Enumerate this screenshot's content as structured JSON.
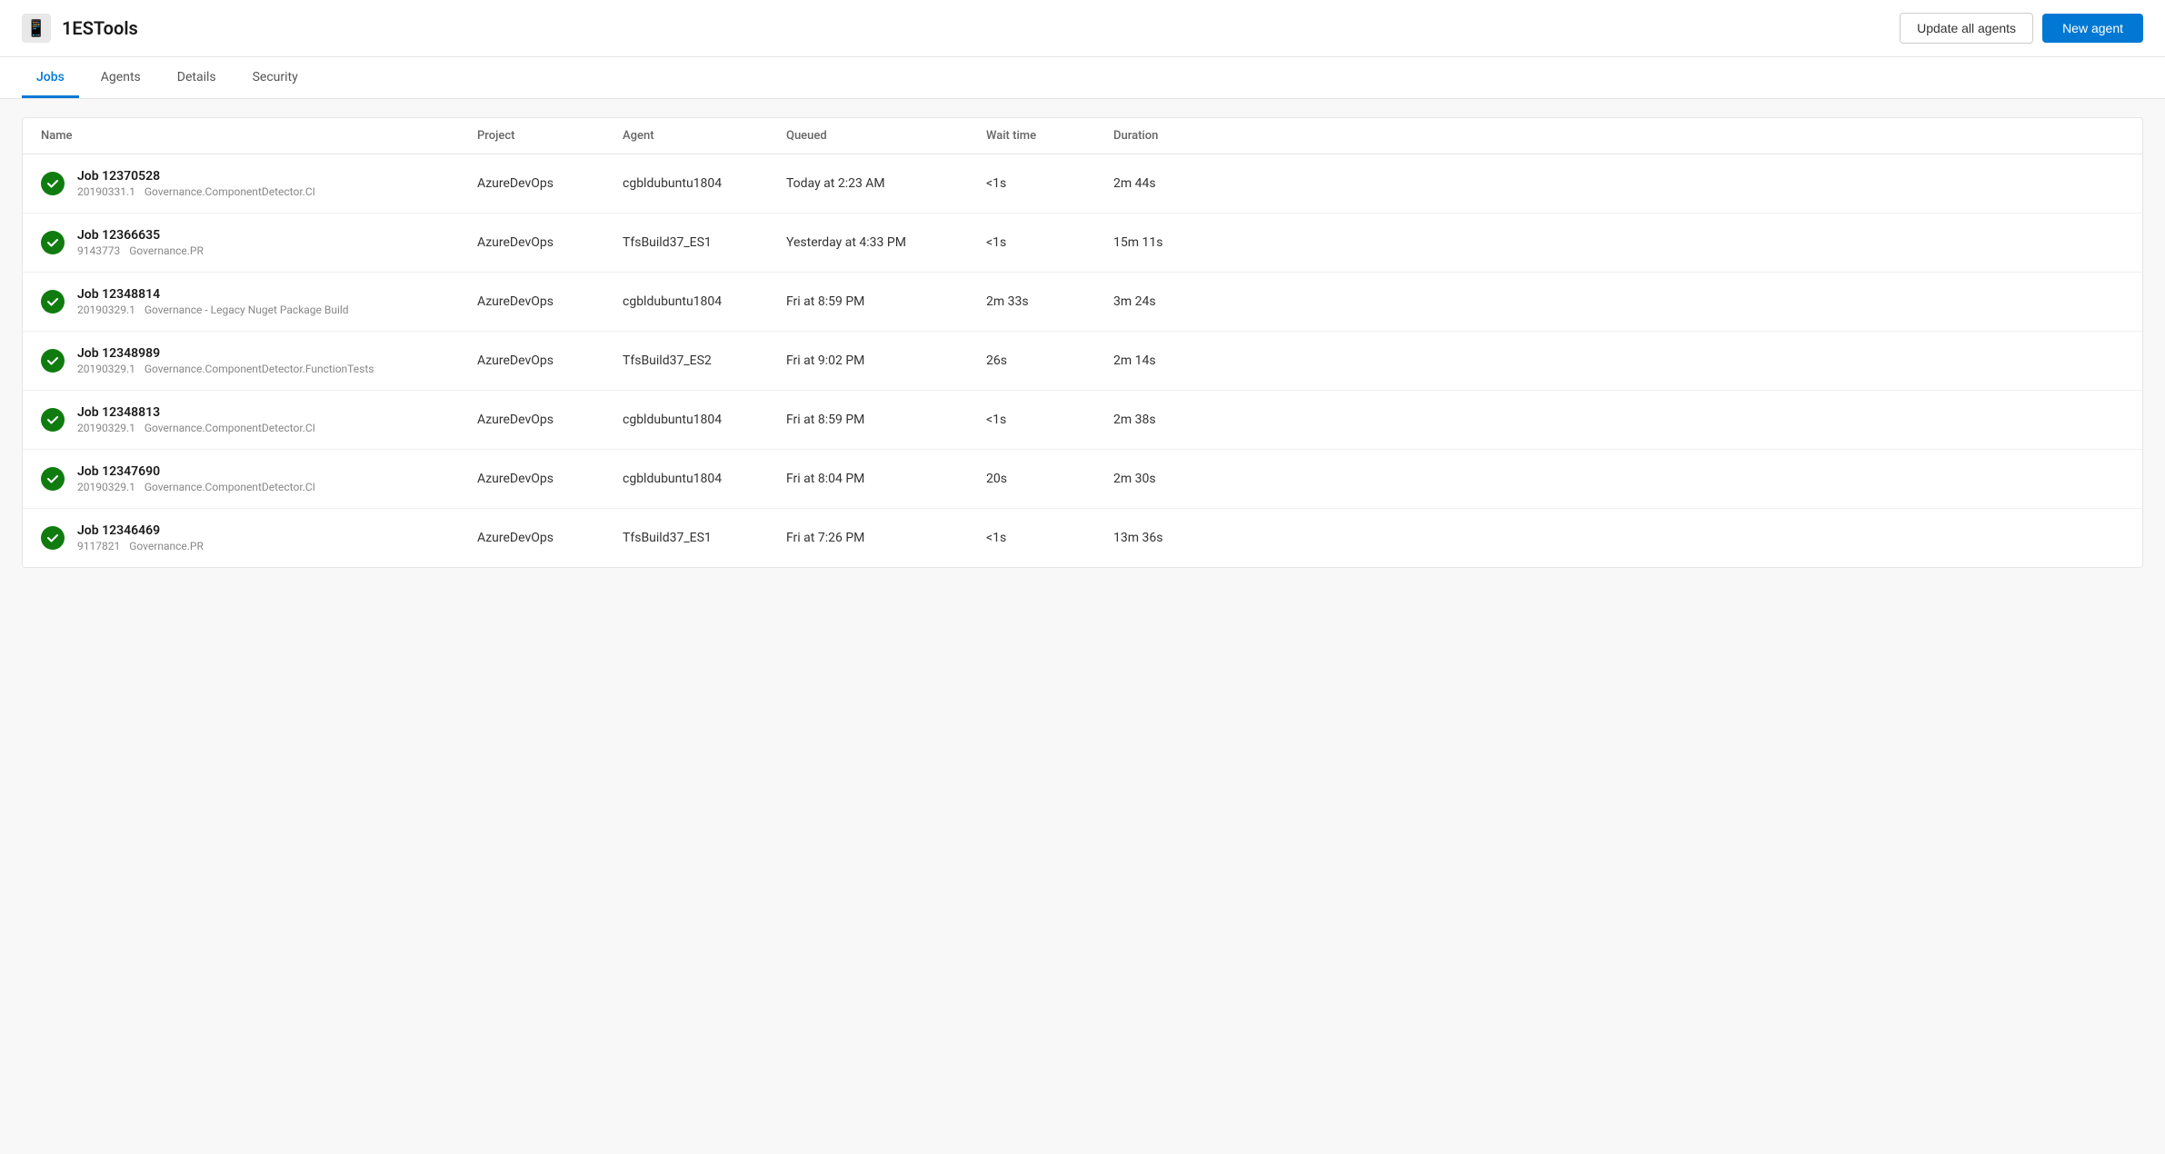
{
  "header": {
    "icon": "📱",
    "title": "1ESTools",
    "update_button": "Update all agents",
    "new_button": "New agent"
  },
  "tabs": [
    {
      "label": "Jobs",
      "active": true
    },
    {
      "label": "Agents",
      "active": false
    },
    {
      "label": "Details",
      "active": false
    },
    {
      "label": "Security",
      "active": false
    }
  ],
  "table": {
    "columns": [
      "Name",
      "Project",
      "Agent",
      "Queued",
      "Wait time",
      "Duration"
    ],
    "rows": [
      {
        "id": "Job 12370528",
        "sub1": "20190331.1",
        "sub2": "Governance.ComponentDetector.CI",
        "project": "AzureDevOps",
        "agent": "cgbldubuntu1804",
        "queued": "Today at 2:23 AM",
        "wait_time": "<1s",
        "duration": "2m 44s"
      },
      {
        "id": "Job 12366635",
        "sub1": "9143773",
        "sub2": "Governance.PR",
        "project": "AzureDevOps",
        "agent": "TfsBuild37_ES1",
        "queued": "Yesterday at 4:33 PM",
        "wait_time": "<1s",
        "duration": "15m 11s"
      },
      {
        "id": "Job 12348814",
        "sub1": "20190329.1",
        "sub2": "Governance - Legacy Nuget Package Build",
        "project": "AzureDevOps",
        "agent": "cgbldubuntu1804",
        "queued": "Fri at 8:59 PM",
        "wait_time": "2m 33s",
        "duration": "3m 24s"
      },
      {
        "id": "Job 12348989",
        "sub1": "20190329.1",
        "sub2": "Governance.ComponentDetector.FunctionTests",
        "project": "AzureDevOps",
        "agent": "TfsBuild37_ES2",
        "queued": "Fri at 9:02 PM",
        "wait_time": "26s",
        "duration": "2m 14s"
      },
      {
        "id": "Job 12348813",
        "sub1": "20190329.1",
        "sub2": "Governance.ComponentDetector.CI",
        "project": "AzureDevOps",
        "agent": "cgbldubuntu1804",
        "queued": "Fri at 8:59 PM",
        "wait_time": "<1s",
        "duration": "2m 38s"
      },
      {
        "id": "Job 12347690",
        "sub1": "20190329.1",
        "sub2": "Governance.ComponentDetector.CI",
        "project": "AzureDevOps",
        "agent": "cgbldubuntu1804",
        "queued": "Fri at 8:04 PM",
        "wait_time": "20s",
        "duration": "2m 30s"
      },
      {
        "id": "Job 12346469",
        "sub1": "9117821",
        "sub2": "Governance.PR",
        "project": "AzureDevOps",
        "agent": "TfsBuild37_ES1",
        "queued": "Fri at 7:26 PM",
        "wait_time": "<1s",
        "duration": "13m 36s"
      }
    ]
  }
}
